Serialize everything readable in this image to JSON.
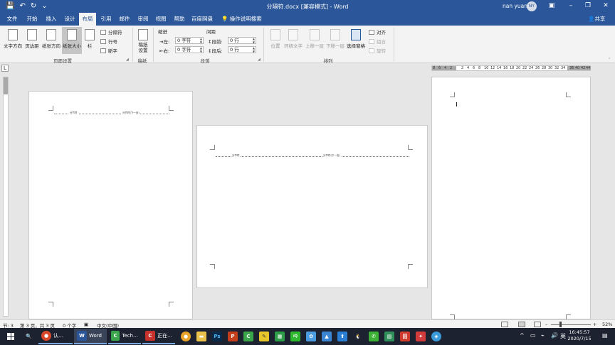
{
  "window": {
    "title": "分隔符.docx [兼容模式] - Word",
    "user_name": "nan yuan",
    "user_initials": "NY"
  },
  "qat": {
    "save_icon": "💾",
    "undo_icon": "↶",
    "redo_icon": "↻",
    "customize_icon": "⌄"
  },
  "tabs": [
    {
      "label": "文件"
    },
    {
      "label": "开始"
    },
    {
      "label": "插入"
    },
    {
      "label": "设计"
    },
    {
      "label": "布局"
    },
    {
      "label": "引用"
    },
    {
      "label": "邮件"
    },
    {
      "label": "审阅"
    },
    {
      "label": "视图"
    },
    {
      "label": "帮助"
    },
    {
      "label": "百度网盘"
    }
  ],
  "tell_me": "操作说明搜索",
  "share": "共享",
  "ribbon": {
    "page_setup": {
      "label": "页面设置",
      "text_direction": "文字方向",
      "margins": "页边距",
      "orientation": "纸张方向",
      "size": "纸张大小",
      "columns": "栏",
      "breaks": "分隔符",
      "line_numbers": "行号",
      "hyphenation": "断字"
    },
    "draft_paper": {
      "label": "稿纸",
      "button": "稿纸设置"
    },
    "paragraph": {
      "label": "段落",
      "indent_header": "缩进",
      "spacing_header": "间距",
      "left_label": "左:",
      "left_value": "0 字符",
      "right_label": "右:",
      "right_value": "0 字符",
      "before_label": "段前:",
      "before_value": "0 行",
      "after_label": "段后:",
      "after_value": "0 行"
    },
    "arrange": {
      "label": "排列",
      "position": "位置",
      "wrap_text": "环绕文字",
      "bring_forward": "上移一层",
      "send_backward": "下移一层",
      "selection_pane": "选择窗格",
      "align": "对齐",
      "group": "组合",
      "rotate": "旋转"
    }
  },
  "ruler_numbers": [
    "8",
    "6",
    "4",
    "2",
    "2",
    "4",
    "6",
    "8",
    "10",
    "12",
    "14",
    "16",
    "18",
    "20",
    "22",
    "24",
    "26",
    "28",
    "30",
    "32",
    "34",
    "36",
    "40",
    "42",
    "44",
    "46"
  ],
  "pages": {
    "section_break_label": "分节符",
    "section_break_next": "分节符(下一页)"
  },
  "status": {
    "section": "节: 3",
    "page": "第 3 页，共 3 页",
    "words": "0 个字",
    "language": "中文(中国)",
    "zoom": "52%"
  },
  "taskbar": {
    "apps": [
      {
        "label": "认…",
        "icon": "chrome-icon"
      },
      {
        "label": "Word",
        "icon": "word-icon"
      },
      {
        "label": "Tech…",
        "icon": "camtasia-icon"
      },
      {
        "label": "正在…",
        "icon": "recorder-icon"
      }
    ],
    "time": "16:45:57",
    "date": "2020/7/15",
    "ime": "英"
  }
}
